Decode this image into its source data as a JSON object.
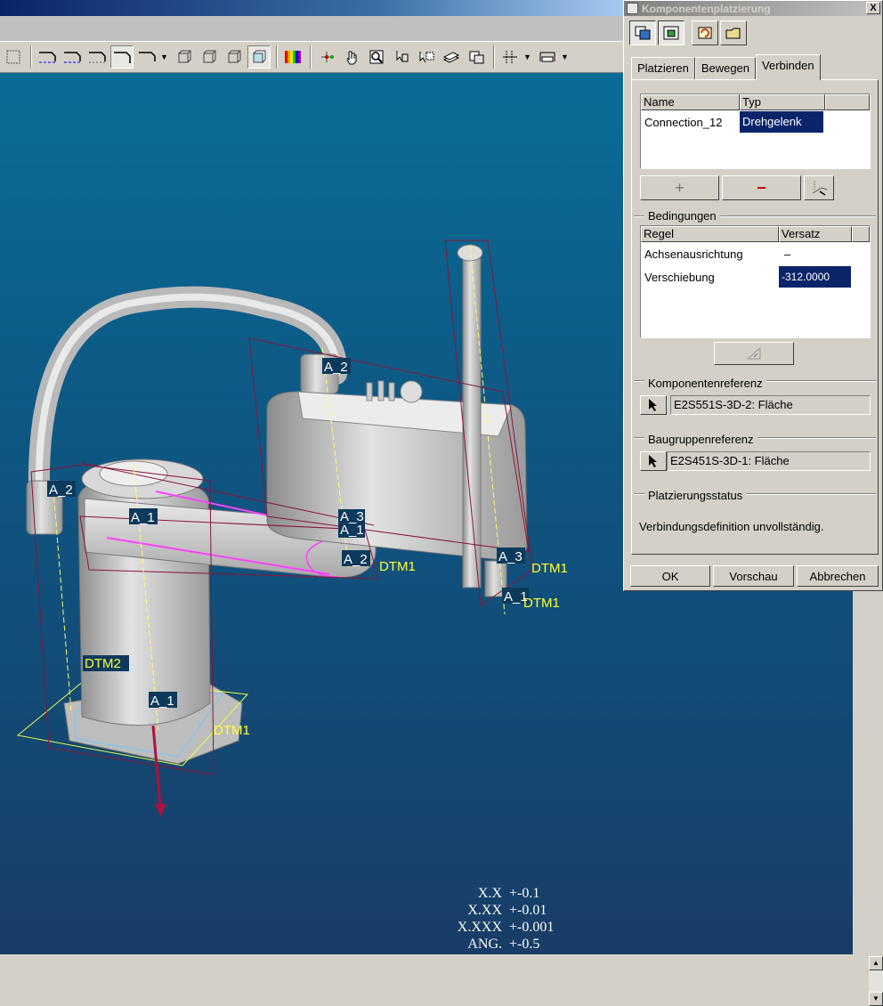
{
  "toolbar": {
    "icons": [
      "datum-display-icon",
      "datum-plane-icon",
      "datum-axis-icon",
      "datum-point-icon",
      "coord-sys-icon",
      "spin-center-icon",
      "wireframe-icon",
      "hidden-line-icon",
      "no-hidden-icon",
      "shading-icon",
      "color-appearance-icon",
      "connect-icon",
      "drag-icon",
      "zoom-icon",
      "component-icon",
      "annotation-icon",
      "layer-icon",
      "camera-icon",
      "mechanism-icon",
      "measure-icon"
    ]
  },
  "viewport": {
    "background_top": "#0a6d97",
    "background_bottom": "#183d66",
    "labels": {
      "base_a1": "A_1",
      "base_dtm1": "DTM1",
      "base_dtm2": "DTM2",
      "column_a2": "A_2",
      "arm1_a1": "A_1",
      "elbow_a2": "A_2",
      "mid_a3": "A_3",
      "mid_a1": "A_1",
      "mid_a2": "A_2",
      "mid_dtm1": "DTM1",
      "end_a3": "A_3",
      "end_dtm1": "DTM1",
      "end_a1": "A_1",
      "end_dtm1_b": "DTM1"
    }
  },
  "tolerances": [
    {
      "key": "X.X",
      "value": "+-0.1"
    },
    {
      "key": "X.XX",
      "value": "+-0.01"
    },
    {
      "key": "X.XXX",
      "value": "+-0.001"
    },
    {
      "key": "ANG.",
      "value": "+-0.5"
    }
  ],
  "dialog": {
    "title": "Komponentenplatzierung",
    "close_label": "X",
    "tabs": [
      "Platzieren",
      "Bewegen",
      "Verbinden"
    ],
    "active_tab": "Verbinden",
    "connections": {
      "headers": [
        "Name",
        "Typ"
      ],
      "rows": [
        {
          "name": "Connection_12",
          "type": "Drehgelenk"
        }
      ]
    },
    "add_label": "+",
    "remove_label": "−",
    "bedingungen": {
      "title": "Bedingungen",
      "headers": [
        "Regel",
        "Versatz"
      ],
      "rows": [
        {
          "rule": "Achsenausrichtung",
          "offset": "–"
        },
        {
          "rule": "Verschiebung",
          "offset": "-312.0000"
        }
      ]
    },
    "komponentenreferenz": {
      "title": "Komponentenreferenz",
      "value": "E2S551S-3D-2: Fläche"
    },
    "baugruppenreferenz": {
      "title": "Baugruppenreferenz",
      "value": "E2S451S-3D-1: Fläche"
    },
    "platzierungsstatus": {
      "title": "Platzierungsstatus",
      "text": "Verbindungsdefinition unvollständig."
    },
    "ok_label": "OK",
    "preview_label": "Vorschau",
    "cancel_label": "Abbrechen"
  }
}
